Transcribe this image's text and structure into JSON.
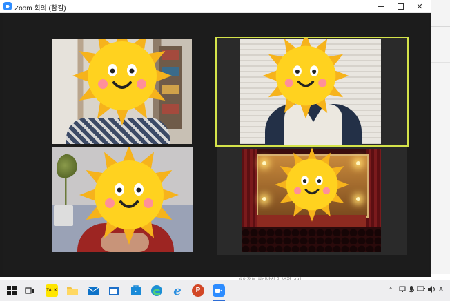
{
  "window": {
    "title": "Zoom 회의 (참김)",
    "controls": {
      "minimize": "minimize",
      "maximize": "maximize",
      "close": "close"
    }
  },
  "background_page": {
    "footer_text": "개인정보 처리방침 및 법적 고지"
  },
  "participants": [
    {
      "id": "p1",
      "face": "sun-mask",
      "active_speaker": false
    },
    {
      "id": "p2",
      "face": "sun-mask",
      "active_speaker": true,
      "highlight_color": "#d4e34a"
    },
    {
      "id": "p3",
      "face": "sun-mask",
      "active_speaker": false
    },
    {
      "id": "p4",
      "face": "sun-mask",
      "active_speaker": false,
      "virtual_background": "theater"
    }
  ],
  "taskbar": {
    "items": [
      {
        "name": "windows-start-icon"
      },
      {
        "name": "task-view-icon"
      },
      {
        "name": "kakaotalk-icon",
        "label": "TALK"
      },
      {
        "name": "file-explorer-icon"
      },
      {
        "name": "mail-icon"
      },
      {
        "name": "calendar-icon"
      },
      {
        "name": "store-icon"
      },
      {
        "name": "edge-icon"
      },
      {
        "name": "ie-icon"
      },
      {
        "name": "powerpoint-icon",
        "label": "P"
      },
      {
        "name": "zoom-icon",
        "active": true
      }
    ],
    "tray": {
      "chevron": "^",
      "ime": "A"
    }
  },
  "colors": {
    "zoom_blue": "#2d8cff",
    "meeting_bg": "#1c1c1c",
    "speaker_outline": "#d4e34a",
    "sun_yellow": "#ffd21f",
    "sun_orange": "#f6b31c"
  }
}
